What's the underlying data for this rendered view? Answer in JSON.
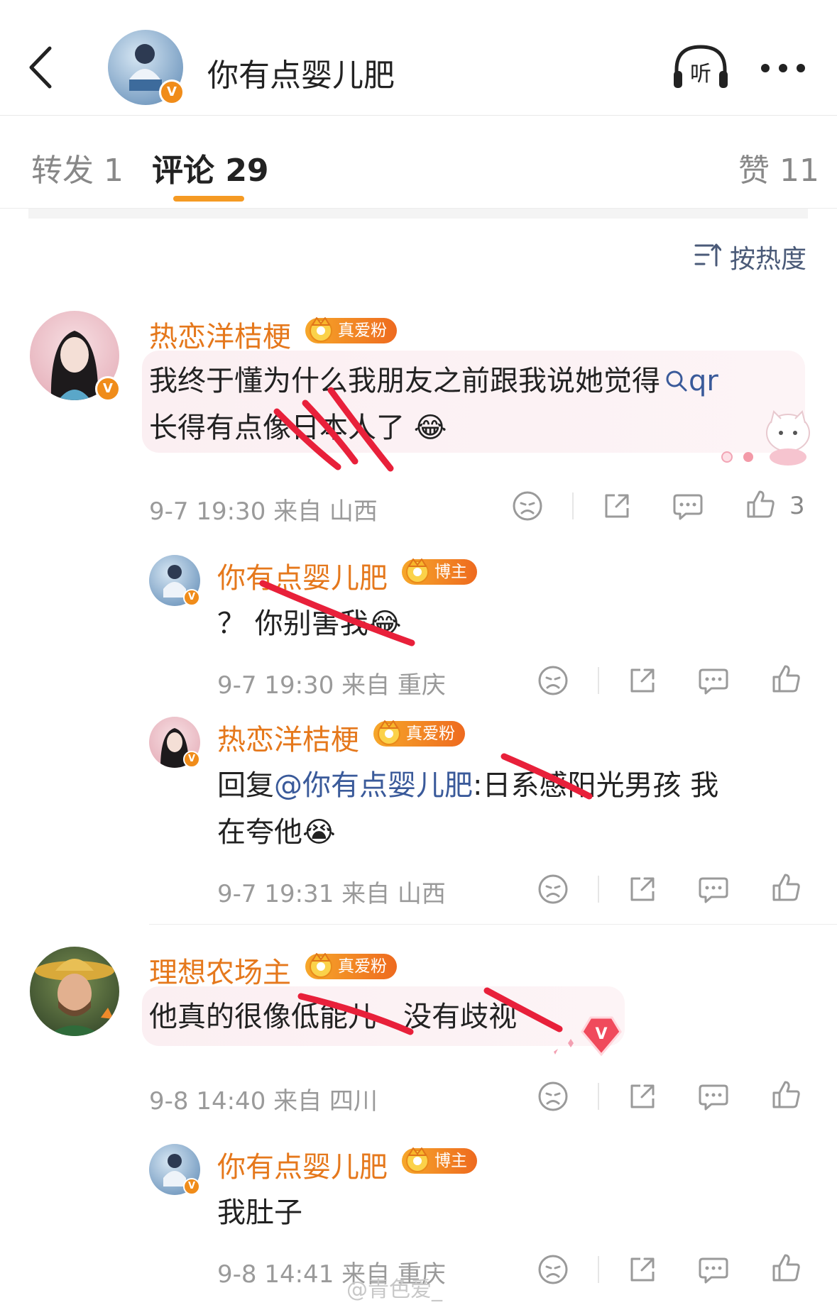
{
  "header": {
    "title": "你有点婴儿肥",
    "listen_label": "听"
  },
  "tabs": [
    {
      "label": "转发 1"
    },
    {
      "label": "评论 29"
    },
    {
      "label": "赞 11"
    }
  ],
  "sort": {
    "label": "按热度"
  },
  "colors": {
    "accent": "#f59a23",
    "username": "#e5781c",
    "link": "#3a5a9a"
  },
  "comments": [
    {
      "user": "热恋洋桔梗",
      "badge": "真爱粉",
      "text_line1": "我终于懂为什么我朋友之前跟我说她觉得",
      "search_tag": "qr",
      "text_line2": "长得有点像日本人了",
      "emoji": "😂",
      "meta": "9-7 19:30 来自 山西",
      "likes": "3",
      "replies": [
        {
          "user": "你有点婴儿肥",
          "badge": "博主",
          "text": "？ 你别害我",
          "emoji": "😂",
          "meta": "9-7 19:30 来自 重庆"
        },
        {
          "user": "热恋洋桔梗",
          "badge": "真爱粉",
          "reply_prefix": "回复",
          "mention": "@你有点婴儿肥",
          "text_line1": ":日系感阳光男孩 我",
          "text_line2": "在夸他",
          "emoji": "😭",
          "meta": "9-7 19:31 来自 山西"
        }
      ]
    },
    {
      "user": "理想农场主",
      "badge": "真爱粉",
      "text": "他真的很像低能儿   没有歧视",
      "meta": "9-8 14:40 来自 四川",
      "replies": [
        {
          "user": "你有点婴儿肥",
          "badge": "博主",
          "text": "我肚子",
          "meta": "9-8 14:41 来自 重庆"
        }
      ]
    }
  ],
  "watermark": "@青色爱_"
}
